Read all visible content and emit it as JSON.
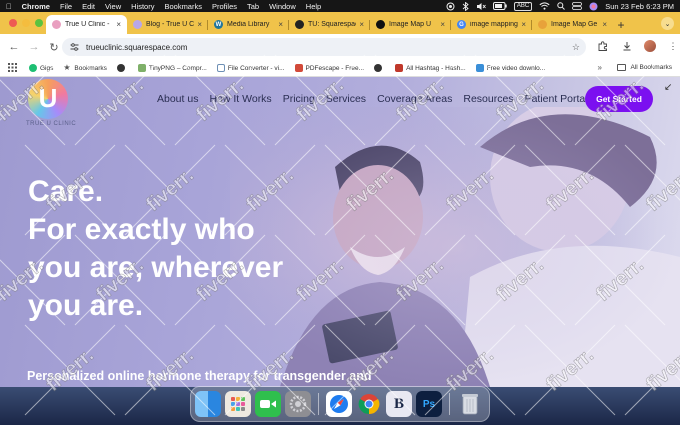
{
  "menubar": {
    "items": [
      "Chrome",
      "File",
      "Edit",
      "View",
      "History",
      "Bookmarks",
      "Profiles",
      "Tab",
      "Window",
      "Help"
    ],
    "input_source": "ABC",
    "clock": "Sun 23 Feb  6:23 PM"
  },
  "tabs": [
    {
      "title": "True U Clinic -",
      "favicon_color": "#e9a0c0",
      "active": true
    },
    {
      "title": "Blog - True U C",
      "favicon_color": "#b9a7e8",
      "active": false
    },
    {
      "title": "Media Library",
      "favicon_color": "#21759b",
      "active": false
    },
    {
      "title": "TU: Squarespac",
      "favicon_color": "#222222",
      "active": false
    },
    {
      "title": "Image Map U",
      "favicon_color": "#111111",
      "active": false
    },
    {
      "title": "image mapping",
      "favicon_color": "#4285f4",
      "active": false
    },
    {
      "title": "Image Map Ge",
      "favicon_color": "#e8a23a",
      "active": false
    }
  ],
  "address_bar": {
    "url": "trueuclinic.squarespace.com"
  },
  "bookmarks": [
    {
      "label": "Gigs",
      "color": "#1dbf73"
    },
    {
      "label": "Bookmarks",
      "color": "#555555"
    },
    {
      "label": "",
      "color": "#333333"
    },
    {
      "label": "TinyPNG – Compr...",
      "color": "#7fb069"
    },
    {
      "label": "File Converter - vi...",
      "color": "#6d8fb5"
    },
    {
      "label": "PDFescape - Free...",
      "color": "#d24a3a"
    },
    {
      "label": "",
      "color": "#333333"
    },
    {
      "label": "All Hashtag - Hash...",
      "color": "#c0392b"
    },
    {
      "label": "Free video downlo...",
      "color": "#3a8fd8"
    }
  ],
  "bookmarks_all": "All Bookmarks",
  "site": {
    "logo_letter": "U",
    "logo_text": "TRUE U CLINIC",
    "nav": [
      "About us",
      "How It Works",
      "Pricing",
      "Services",
      "Coverage Areas",
      "Resources",
      "Patient Portal"
    ],
    "cta": "Get Started",
    "hero_lines": [
      "Care.",
      "For exactly who",
      "you are, wherever",
      "you are."
    ],
    "subheading": "Personalized online hormone therapy for transgender and"
  },
  "watermark_text": "fiverr.",
  "dock": [
    {
      "name": "finder",
      "color": "#3c9bf0",
      "glyph": ""
    },
    {
      "name": "launchpad",
      "color": "#e7b86a",
      "glyph": ""
    },
    {
      "name": "facetime",
      "color": "#2fbf4d",
      "glyph": ""
    },
    {
      "name": "system-settings",
      "color": "#8e8e93",
      "glyph": ""
    },
    {
      "name": "safari",
      "color": "#1e7cf0",
      "glyph": ""
    },
    {
      "name": "chrome",
      "color": "#ffffff",
      "glyph": ""
    },
    {
      "name": "bbedit",
      "color": "#e8e8f2",
      "glyph": "B"
    },
    {
      "name": "photoshop",
      "color": "#0d1f3f",
      "glyph": "Ps"
    },
    {
      "name": "trash",
      "color": "#d9dde4",
      "glyph": ""
    }
  ]
}
